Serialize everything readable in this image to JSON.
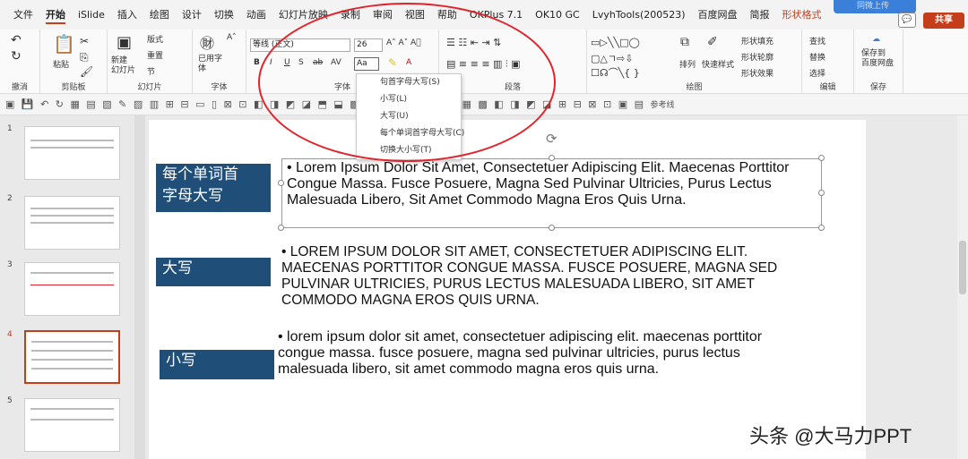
{
  "menu": {
    "tabs": [
      "文件",
      "开始",
      "iSlide",
      "插入",
      "绘图",
      "设计",
      "切换",
      "动画",
      "幻灯片放映",
      "录制",
      "审阅",
      "视图",
      "帮助",
      "OKPlus 7.1",
      "OK10 GC",
      "LvyhTools(200523)",
      "百度网盘",
      "简报",
      "形状格式"
    ],
    "cloud_label": "同微上传",
    "comment_label": "💬",
    "share_label": "共享"
  },
  "ribbon": {
    "groups": {
      "undo": "撤消",
      "clipboard": "剪贴板",
      "slides": "幻灯片",
      "font_small": "字体",
      "font": "字体",
      "paragraph": "段落",
      "drawing": "绘图",
      "editing": "编辑",
      "save": "保存"
    },
    "paste": "粘贴",
    "new_slide": "新建\n幻灯片",
    "layout": "版式",
    "reset": "重置",
    "section": "节",
    "used_font": "已用字\n体",
    "font_name": "等线 (正文)",
    "font_size": "26",
    "case_button": "Aa",
    "arrange": "排列",
    "quick_styles": "快速样式",
    "shape_fill": "形状填充",
    "shape_outline": "形状轮廓",
    "shape_effects": "形状效果",
    "find": "查找",
    "replace": "替换",
    "select": "选择",
    "save_to_baidu": "保存到\n百度网盘",
    "reference_line": "参考线"
  },
  "case_menu": [
    "句首字母大写(S)",
    "小写(L)",
    "大写(U)",
    "每个单词首字母大写(C)",
    "切换大小写(T)"
  ],
  "thumbnails": [
    "1",
    "2",
    "3",
    "4",
    "5"
  ],
  "slide": {
    "label1": "每个单词首\n字母大写",
    "text1": "• Lorem Ipsum Dolor Sit Amet, Consectetuer Adipiscing Elit. Maecenas Porttitor Congue Massa. Fusce Posuere, Magna Sed Pulvinar Ultricies, Purus Lectus Malesuada Libero, Sit Amet Commodo Magna Eros Quis Urna.",
    "label2": "大写",
    "text2": "• LOREM IPSUM DOLOR SIT AMET, CONSECTETUER ADIPISCING ELIT. MAECENAS PORTTITOR CONGUE MASSA. FUSCE POSUERE, MAGNA SED PULVINAR ULTRICIES, PURUS LECTUS MALESUADA LIBERO, SIT AMET COMMODO MAGNA EROS QUIS URNA.",
    "label3": "小写",
    "text3": "• lorem ipsum dolor sit amet, consectetuer adipiscing elit. maecenas porttitor congue massa. fusce posuere, magna sed pulvinar ultricies, purus lectus malesuada libero, sit amet commodo magna eros quis urna."
  },
  "watermark": "头条 @大马力PPT",
  "colors": {
    "accent": "#c43e1c",
    "label_bg": "#1f4e79",
    "annotation": "#e0242b"
  }
}
